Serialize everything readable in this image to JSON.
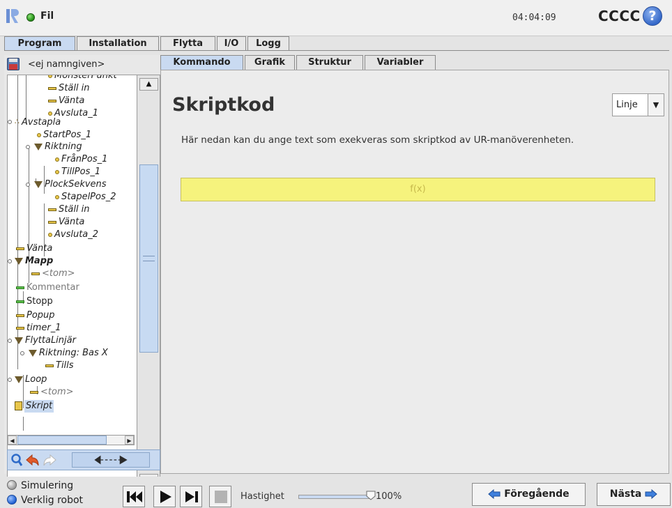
{
  "header": {
    "file_label": "Fil",
    "clock": "04:04:09",
    "robot_name": "CCCC",
    "help_symbol": "?"
  },
  "main_tabs": [
    {
      "label": "Program",
      "active": true
    },
    {
      "label": "Installation",
      "active": false
    },
    {
      "label": "Flytta",
      "active": false
    },
    {
      "label": "I/O",
      "active": false
    },
    {
      "label": "Logg",
      "active": false
    }
  ],
  "left_panel": {
    "program_name": "<ej namngiven>",
    "tree": [
      {
        "label": "MonsterPunkt",
        "icon": "waypoint"
      },
      {
        "label": "Ställ in",
        "icon": "bar"
      },
      {
        "label": "Vänta",
        "icon": "bar"
      },
      {
        "label": "Avsluta_1",
        "icon": "waypoint"
      },
      {
        "label": "Avstapla",
        "icon": "pallet"
      },
      {
        "label": "StartPos_1",
        "icon": "waypoint"
      },
      {
        "label": "Riktning",
        "icon": "triangle"
      },
      {
        "label": "FrånPos_1",
        "icon": "waypoint"
      },
      {
        "label": "TillPos_1",
        "icon": "waypoint"
      },
      {
        "label": "PlockSekvens",
        "icon": "triangle"
      },
      {
        "label": "StapelPos_2",
        "icon": "waypoint"
      },
      {
        "label": "Ställ in",
        "icon": "bar"
      },
      {
        "label": "Vänta",
        "icon": "bar"
      },
      {
        "label": "Avsluta_2",
        "icon": "waypoint"
      },
      {
        "label": "Vänta",
        "icon": "bar"
      },
      {
        "label": "Mapp",
        "icon": "triangle"
      },
      {
        "label": "<tom>",
        "icon": "bar"
      },
      {
        "label": "Kommentar",
        "icon": "bar-green"
      },
      {
        "label": "Stopp",
        "icon": "bar-green"
      },
      {
        "label": "Popup",
        "icon": "bar"
      },
      {
        "label": "timer_1",
        "icon": "bar"
      },
      {
        "label": "FlyttaLinjär",
        "icon": "triangle"
      },
      {
        "label": "Riktning: Bas X",
        "icon": "triangle"
      },
      {
        "label": "Tills",
        "icon": "bar"
      },
      {
        "label": "Loop",
        "icon": "triangle"
      },
      {
        "label": "<tom>",
        "icon": "bar"
      },
      {
        "label": "Skript",
        "icon": "script"
      }
    ]
  },
  "right_tabs": [
    {
      "label": "Kommando",
      "active": true
    },
    {
      "label": "Grafik",
      "active": false
    },
    {
      "label": "Struktur",
      "active": false
    },
    {
      "label": "Variabler",
      "active": false
    }
  ],
  "content": {
    "title": "Skriptkod",
    "mode_select": "Linje",
    "description": "Här nedan kan du ange text som exekveras som skriptkod av UR-manöverenheten.",
    "script_placeholder": "f(x)"
  },
  "footer": {
    "simulation_label": "Simulering",
    "real_robot_label": "Verklig robot",
    "speed_label": "Hastighet",
    "speed_value": "100%",
    "speed_fraction": 1.0,
    "prev_label": "Föregående",
    "next_label": "Nästa"
  },
  "colors": {
    "accent_blue": "#c9daf1",
    "script_yellow": "#f6f37d",
    "status_green": "#2a9a1c",
    "help_blue": "#3468c9"
  }
}
